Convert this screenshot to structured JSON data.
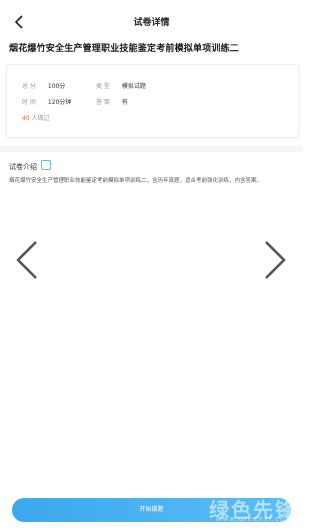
{
  "header": {
    "back_icon": "chevron-left-icon",
    "title": "试卷详情"
  },
  "exam": {
    "title": "烟花爆竹安全生产管理职业技能鉴定考前模拟单项训练二",
    "score_label": "总  分",
    "score_value": "100分",
    "type_label": "类  型",
    "type_value": "模拟试题",
    "time_label": "时  间",
    "time_value": "120分钟",
    "answer_label": "答  案",
    "answer_value": "有",
    "attend_count": "40",
    "attend_suffix": "人做过"
  },
  "intro": {
    "heading": "试卷介绍",
    "text": "烟花爆竹安全生产管理职业技能鉴定考前模拟单项训练二，含历年真题，适合考前强化训练，内含答案。"
  },
  "footer": {
    "start_label": "开始做题"
  },
  "watermark": {
    "logo": "绿色先锋",
    "url": "www.greenxf.com"
  },
  "colors": {
    "accent": "#3ca8f0",
    "attend": "#f0643a"
  }
}
